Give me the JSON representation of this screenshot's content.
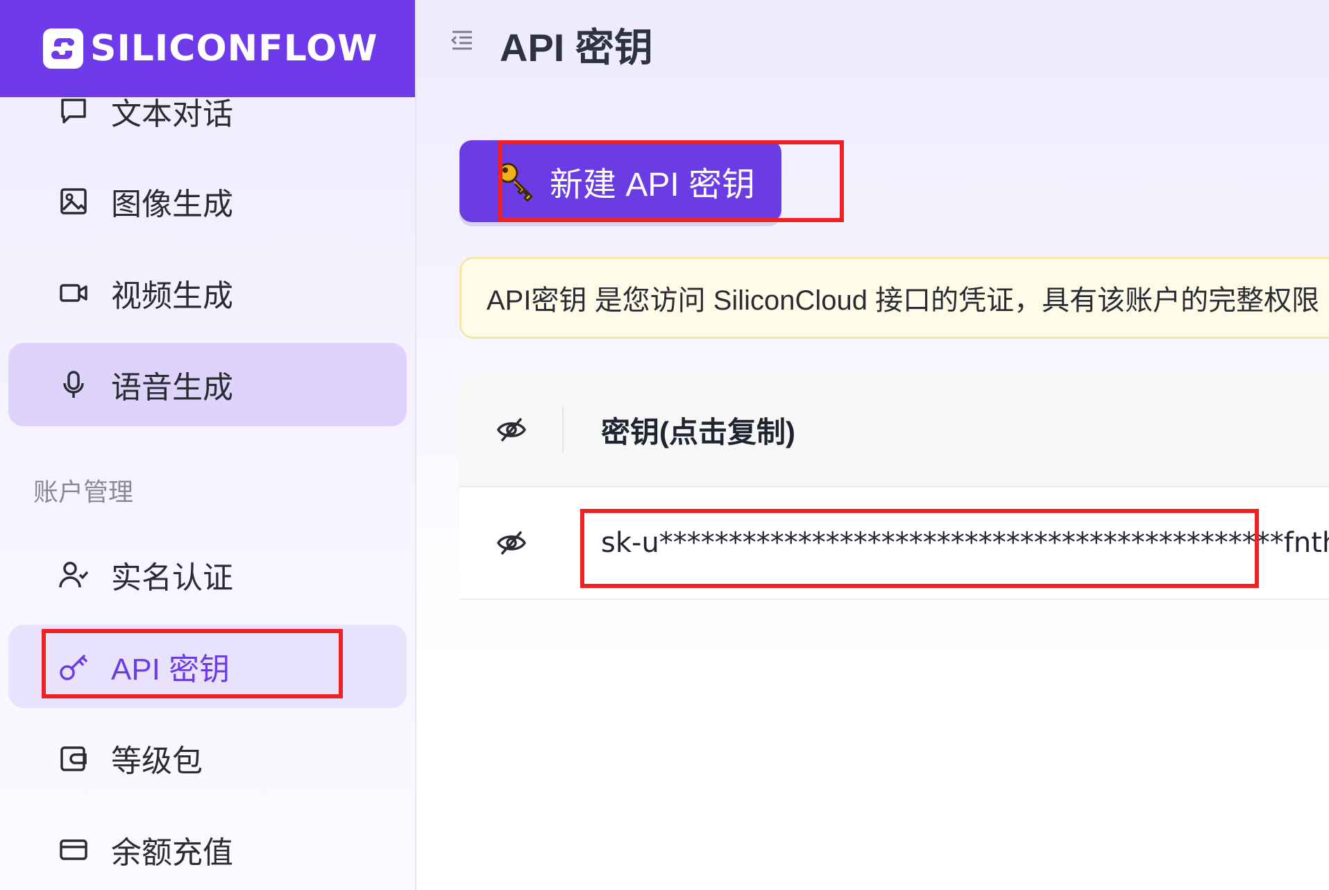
{
  "brand": {
    "name": "SILICONFLOW",
    "color": "#6f3bea"
  },
  "sidebar": {
    "items": [
      {
        "label": "文本对话",
        "icon": "chat-bubble-icon"
      },
      {
        "label": "图像生成",
        "icon": "image-icon"
      },
      {
        "label": "视频生成",
        "icon": "video-camera-icon"
      },
      {
        "label": "语音生成",
        "icon": "microphone-icon"
      }
    ],
    "section_label": "账户管理",
    "account_items": [
      {
        "label": "实名认证",
        "icon": "user-check-icon"
      },
      {
        "label": "API 密钥",
        "icon": "key-icon"
      },
      {
        "label": "等级包",
        "icon": "wallet-icon"
      },
      {
        "label": "余额充值",
        "icon": "credit-card-icon"
      }
    ]
  },
  "header": {
    "title": "API 密钥"
  },
  "main": {
    "create_button_label": "新建 API 密钥",
    "notice": "API密钥 是您访问 SiliconCloud 接口的凭证，具有该账户的完整权限",
    "table": {
      "header_label": "密钥(点击复制)",
      "rows": [
        {
          "key": "sk-u*********************************************fnth"
        }
      ]
    }
  },
  "colors": {
    "accent": "#6b3ce4",
    "highlight": "#ee2222",
    "notice_bg": "#fefce9"
  }
}
